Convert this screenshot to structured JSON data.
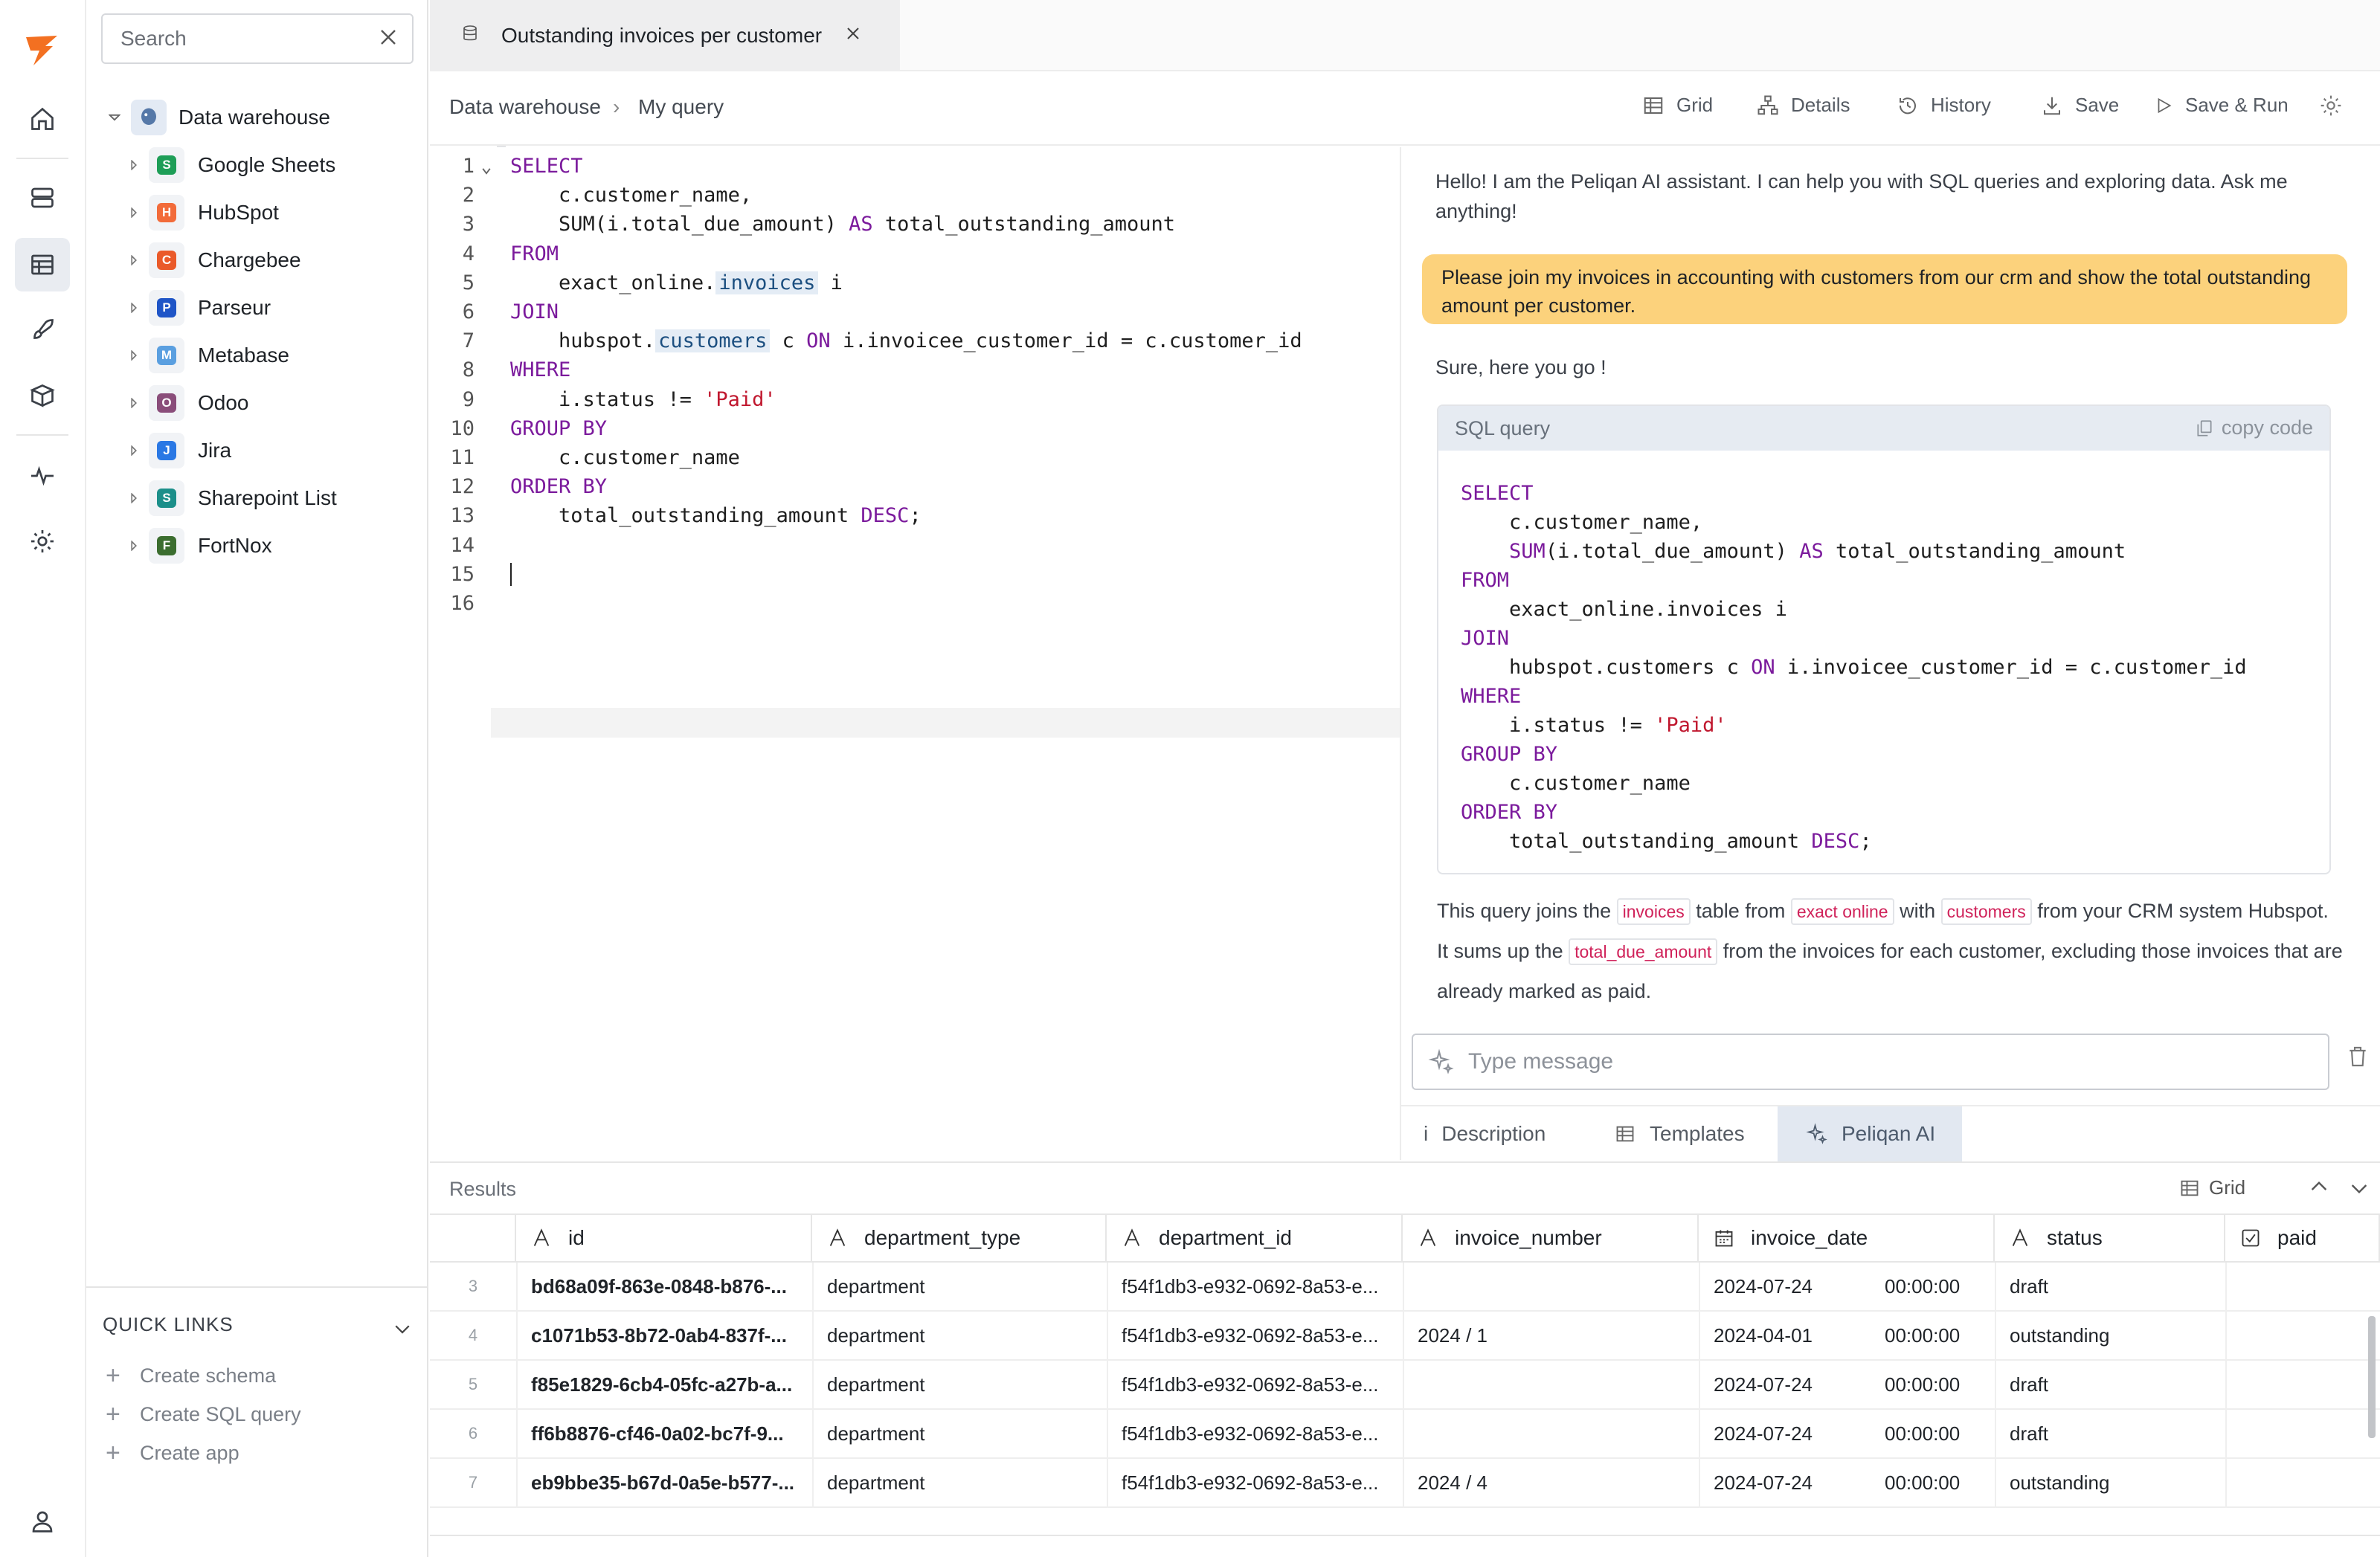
{
  "rail": {
    "items": [
      "logo-icon",
      "home-icon",
      "database-icon",
      "table-icon",
      "rocket-icon",
      "box-icon",
      "activity-icon",
      "settings-icon",
      "user-icon"
    ]
  },
  "sidebar": {
    "search_placeholder": "Search",
    "root": {
      "label": "Data warehouse"
    },
    "items": [
      {
        "label": "Google Sheets",
        "color": "#1e9e57"
      },
      {
        "label": "HubSpot",
        "color": "#f26b3a"
      },
      {
        "label": "Chargebee",
        "color": "#ea5a2a"
      },
      {
        "label": "Parseur",
        "color": "#1f55c7"
      },
      {
        "label": "Metabase",
        "color": "#5a9fe0"
      },
      {
        "label": "Odoo",
        "color": "#8a4d7a"
      },
      {
        "label": "Jira",
        "color": "#2a78e4"
      },
      {
        "label": "Sharepoint List",
        "color": "#1c8f8a"
      },
      {
        "label": "FortNox",
        "color": "#3b6d2f"
      }
    ],
    "quick_links": {
      "title": "QUICK LINKS",
      "items": [
        "Create schema",
        "Create SQL query",
        "Create app"
      ]
    }
  },
  "tabs": [
    {
      "label": "Outstanding invoices per customer"
    }
  ],
  "breadcrumb": {
    "root": "Data warehouse",
    "sep": "›",
    "current": "My query"
  },
  "toolbar": {
    "grid": "Grid",
    "details": "Details",
    "history": "History",
    "save": "Save",
    "save_run": "Save & Run"
  },
  "editor": {
    "line_numbers": [
      "1",
      "2",
      "3",
      "4",
      "5",
      "6",
      "7",
      "8",
      "9",
      "10",
      "11",
      "12",
      "13",
      "14",
      "15",
      "16"
    ]
  },
  "assistant": {
    "greeting": "Hello! I am the Peliqan AI assistant. I can help you with SQL queries and exploring data. Ask me anything!",
    "user_message": "Please join my invoices in accounting with customers from our crm and show the total outstanding amount per customer.",
    "reply": "Sure, here you go !",
    "sql_box_title": "SQL query",
    "copy_label": "copy code",
    "explain_1": "This query joins the",
    "tag_invoices": "invoices",
    "explain_2": "table from",
    "tag_exact": "exact online",
    "explain_3": "with",
    "tag_customers": "customers",
    "explain_4": "from your CRM system Hubspot. It sums up the",
    "tag_amount": "total_due_amount",
    "explain_5": "from the invoices for each customer, excluding those invoices that are already marked as paid.",
    "input_placeholder": "Type message",
    "tabs": {
      "description": "Description",
      "templates": "Templates",
      "ai": "Peliqan AI"
    }
  },
  "results": {
    "title": "Results",
    "view": "Grid",
    "columns": [
      "id",
      "department_type",
      "department_id",
      "invoice_number",
      "invoice_date",
      "status",
      "paid"
    ],
    "rows": [
      {
        "n": "3",
        "id": "bd68a09f-863e-0848-b876-...",
        "type": "department",
        "dept": "f54f1db3-e932-0692-8a53-e...",
        "num": "",
        "date": "2024-07-24",
        "time": "00:00:00",
        "status": "draft"
      },
      {
        "n": "4",
        "id": "c1071b53-8b72-0ab4-837f-...",
        "type": "department",
        "dept": "f54f1db3-e932-0692-8a53-e...",
        "num": "2024 / 1",
        "date": "2024-04-01",
        "time": "00:00:00",
        "status": "outstanding"
      },
      {
        "n": "5",
        "id": "f85e1829-6cb4-05fc-a27b-a...",
        "type": "department",
        "dept": "f54f1db3-e932-0692-8a53-e...",
        "num": "",
        "date": "2024-07-24",
        "time": "00:00:00",
        "status": "draft"
      },
      {
        "n": "6",
        "id": "ff6b8876-cf46-0a02-bc7f-9...",
        "type": "department",
        "dept": "f54f1db3-e932-0692-8a53-e...",
        "num": "",
        "date": "2024-07-24",
        "time": "00:00:00",
        "status": "draft"
      },
      {
        "n": "7",
        "id": "eb9bbe35-b67d-0a5e-b577-...",
        "type": "department",
        "dept": "f54f1db3-e932-0692-8a53-e...",
        "num": "2024 / 4",
        "date": "2024-07-24",
        "time": "00:00:00",
        "status": "outstanding"
      }
    ]
  }
}
